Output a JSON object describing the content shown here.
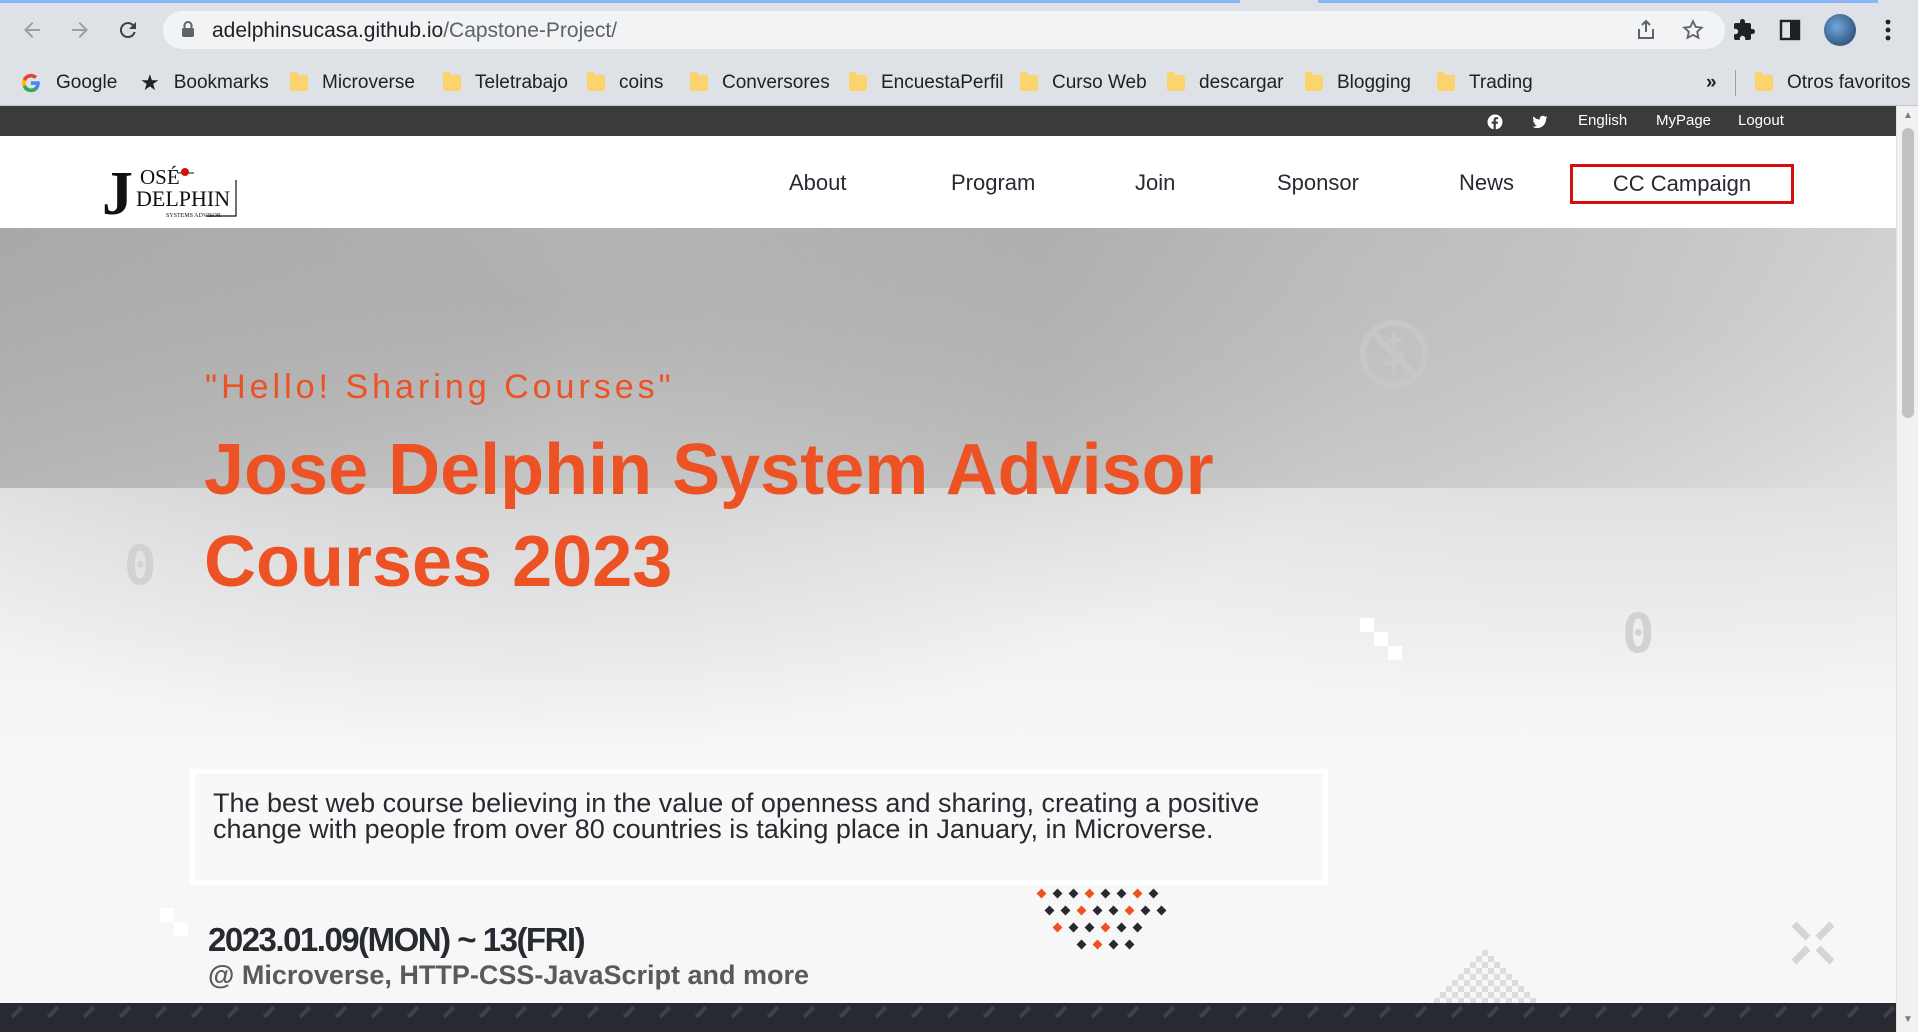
{
  "browser": {
    "url_domain": "adelphinsucasa.github.io",
    "url_path": "/Capstone-Project/",
    "bookmarks": [
      {
        "label": "Google",
        "icon": "google-icon"
      },
      {
        "label": "Bookmarks",
        "icon": "star-icon"
      },
      {
        "label": "Microverse",
        "icon": "folder-icon"
      },
      {
        "label": "Teletrabajo",
        "icon": "folder-icon"
      },
      {
        "label": "coins",
        "icon": "folder-icon"
      },
      {
        "label": "Conversores",
        "icon": "folder-icon"
      },
      {
        "label": "EncuestaPerfil",
        "icon": "folder-icon"
      },
      {
        "label": "Curso Web",
        "icon": "folder-icon"
      },
      {
        "label": "descargar",
        "icon": "folder-icon"
      },
      {
        "label": "Blogging",
        "icon": "folder-icon"
      },
      {
        "label": "Trading",
        "icon": "folder-icon"
      }
    ],
    "overflow_label": "»",
    "other_bookmarks": "Otros favoritos"
  },
  "topbar": {
    "language": "English",
    "mypage": "MyPage",
    "logout": "Logout"
  },
  "logo": {
    "initial": "J",
    "line1": "OSÉ",
    "line2": "DELPHIN",
    "tagline": "SYSTEMS ADVISOR"
  },
  "nav": {
    "about": "About",
    "program": "Program",
    "join": "Join",
    "sponsor": "Sponsor",
    "news": "News",
    "cc_campaign": "CC Campaign"
  },
  "hero": {
    "quote": "\"Hello! Sharing Courses\"",
    "title": "Jose Delphin System Advisor Courses 2023",
    "description": "The best web course believing in the value of openness and sharing, creating a positive change with people from over 80 countries is taking place in January, in Microverse.",
    "date": "2023.01.09(MON) ~ 13(FRI)",
    "venue": "@ Microverse, HTTP-CSS-JavaScript and more",
    "deco_zero": "0"
  },
  "colors": {
    "accent": "#ec5224",
    "dark": "#272a31",
    "highlight_border": "#d40f0f"
  }
}
